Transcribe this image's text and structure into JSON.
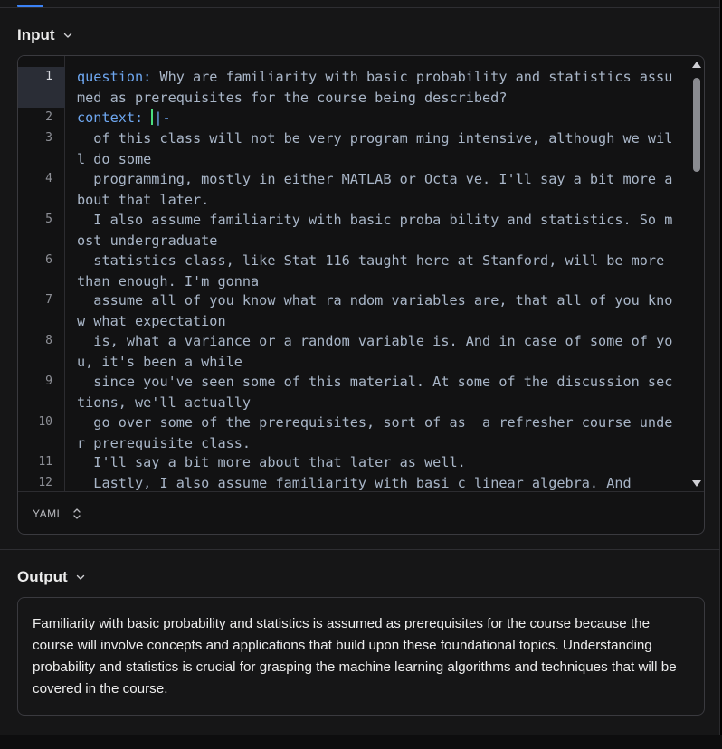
{
  "input": {
    "title": "Input",
    "language": "YAML",
    "gutter": [
      "1",
      "2",
      "3",
      "4",
      "5",
      "6",
      "7",
      "8",
      "9",
      "10",
      "11",
      "12"
    ],
    "lines": [
      {
        "key": "question:",
        "text": " Why are familiarity with basic probability and statistics assumed as prerequisites for the course being described?"
      },
      {
        "key": "context:",
        "text": " ",
        "suffix": "|-"
      },
      {
        "text": "  of this class will not be very program ming intensive, although we will do some"
      },
      {
        "text": "  programming, mostly in either MATLAB or Octa ve. I'll say a bit more about that later."
      },
      {
        "text": "  I also assume familiarity with basic proba bility and statistics. So most undergraduate"
      },
      {
        "text": "  statistics class, like Stat 116 taught here at Stanford, will be more than enough. I'm gonna"
      },
      {
        "text": "  assume all of you know what ra ndom variables are, that all of you know what expectation"
      },
      {
        "text": "  is, what a variance or a random variable is. And in case of some of you, it's been a while"
      },
      {
        "text": "  since you've seen some of this material. At some of the discussion sections, we'll actually"
      },
      {
        "text": "  go over some of the prerequisites, sort of as  a refresher course under prerequisite class."
      },
      {
        "text": "  I'll say a bit more about that later as well."
      },
      {
        "text": "  Lastly, I also assume familiarity with basi c linear algebra. And"
      }
    ]
  },
  "output": {
    "title": "Output",
    "text": "Familiarity with basic probability and statistics is assumed as prerequisites for the course because the course will involve concepts and applications that build upon these foundational topics. Understanding probability and statistics is crucial for grasping the machine learning algorithms and techniques that will be covered in the course."
  },
  "colors": {
    "accent": "#3b82f6",
    "key": "#6ea7f0",
    "cursor": "#4ade80"
  }
}
